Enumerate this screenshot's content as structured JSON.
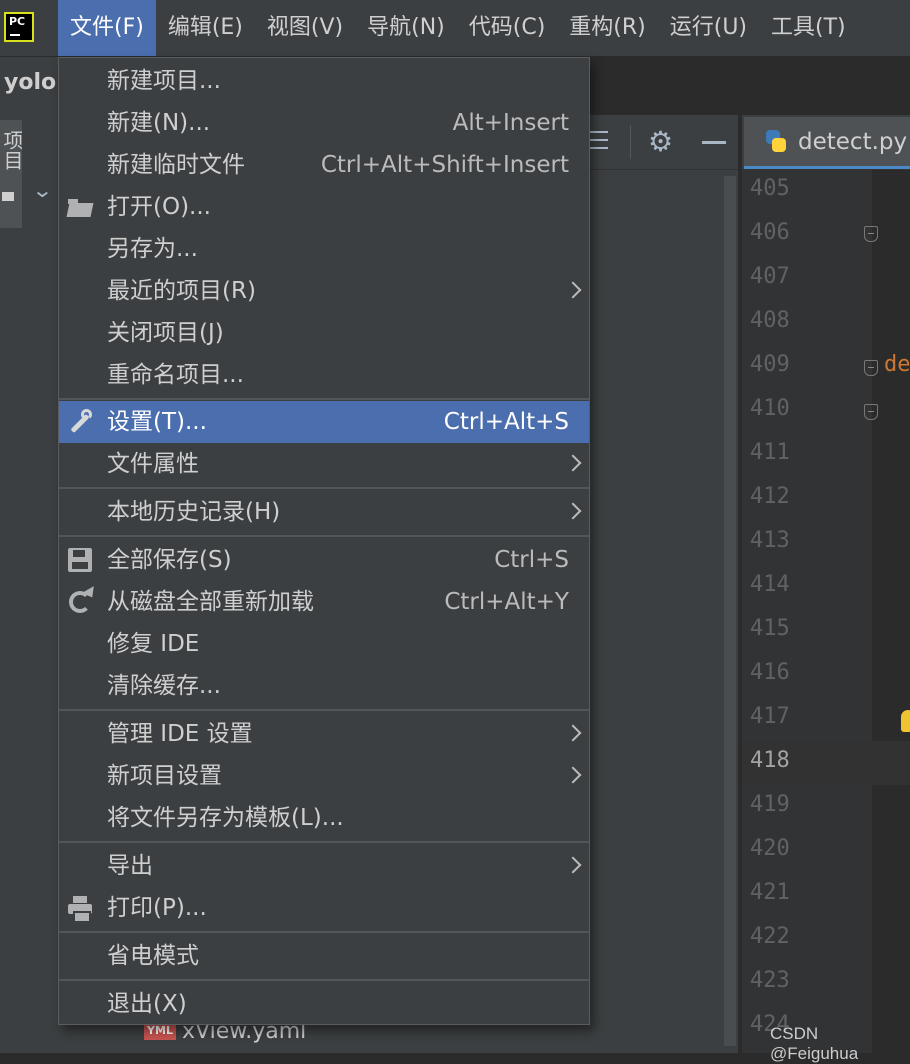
{
  "menubar": {
    "app_icon": "pycharm-logo",
    "items": [
      {
        "label": "文件(F)",
        "active": true
      },
      {
        "label": "编辑(E)"
      },
      {
        "label": "视图(V)"
      },
      {
        "label": "导航(N)"
      },
      {
        "label": "代码(C)"
      },
      {
        "label": "重构(R)"
      },
      {
        "label": "运行(U)"
      },
      {
        "label": "工具(T)"
      }
    ]
  },
  "project": {
    "name": "yolo",
    "side_tab_label": "项目",
    "tree_item": "xView.yaml",
    "tree_item_badge": "YML"
  },
  "editor": {
    "tab_label": "detect.py",
    "line_numbers": [
      "405",
      "406",
      "407",
      "408",
      "409",
      "410",
      "411",
      "412",
      "413",
      "414",
      "415",
      "416",
      "417",
      "418",
      "419",
      "420",
      "421",
      "422",
      "423",
      "424"
    ],
    "current_line": "418",
    "visible_code": "de"
  },
  "file_menu": {
    "items": [
      {
        "label": "新建项目...",
        "shortcut": "",
        "submenu": false,
        "icon": ""
      },
      {
        "label": "新建(N)...",
        "shortcut": "Alt+Insert",
        "submenu": false,
        "icon": ""
      },
      {
        "label": "新建临时文件",
        "shortcut": "Ctrl+Alt+Shift+Insert",
        "submenu": false,
        "icon": ""
      },
      {
        "label": "打开(O)...",
        "shortcut": "",
        "submenu": false,
        "icon": "folder-open-icon"
      },
      {
        "label": "另存为...",
        "shortcut": "",
        "submenu": false,
        "icon": ""
      },
      {
        "label": "最近的项目(R)",
        "shortcut": "",
        "submenu": true,
        "icon": ""
      },
      {
        "label": "关闭项目(J)",
        "shortcut": "",
        "submenu": false,
        "icon": ""
      },
      {
        "label": "重命名项目...",
        "shortcut": "",
        "submenu": false,
        "icon": ""
      },
      {
        "label": "设置(T)...",
        "shortcut": "Ctrl+Alt+S",
        "submenu": false,
        "icon": "wrench-icon",
        "selected": true
      },
      {
        "label": "文件属性",
        "shortcut": "",
        "submenu": true,
        "icon": ""
      },
      {
        "label": "本地历史记录(H)",
        "shortcut": "",
        "submenu": true,
        "icon": ""
      },
      {
        "label": "全部保存(S)",
        "shortcut": "Ctrl+S",
        "submenu": false,
        "icon": "save-icon"
      },
      {
        "label": "从磁盘全部重新加载",
        "shortcut": "Ctrl+Alt+Y",
        "submenu": false,
        "icon": "reload-icon"
      },
      {
        "label": "修复 IDE",
        "shortcut": "",
        "submenu": false,
        "icon": ""
      },
      {
        "label": "清除缓存...",
        "shortcut": "",
        "submenu": false,
        "icon": ""
      },
      {
        "label": "管理 IDE 设置",
        "shortcut": "",
        "submenu": true,
        "icon": ""
      },
      {
        "label": "新项目设置",
        "shortcut": "",
        "submenu": true,
        "icon": ""
      },
      {
        "label": "将文件另存为模板(L)...",
        "shortcut": "",
        "submenu": false,
        "icon": ""
      },
      {
        "label": "导出",
        "shortcut": "",
        "submenu": true,
        "icon": ""
      },
      {
        "label": "打印(P)...",
        "shortcut": "",
        "submenu": false,
        "icon": "print-icon"
      },
      {
        "label": "省电模式",
        "shortcut": "",
        "submenu": false,
        "icon": ""
      },
      {
        "label": "退出(X)",
        "shortcut": "",
        "submenu": false,
        "icon": ""
      }
    ]
  },
  "watermark": "CSDN @Feiguhua",
  "colors": {
    "accent": "#4b6eaf",
    "menu_bg": "#3c3f41",
    "editor_bg": "#2b2b2b",
    "keyword": "#cc7832"
  }
}
